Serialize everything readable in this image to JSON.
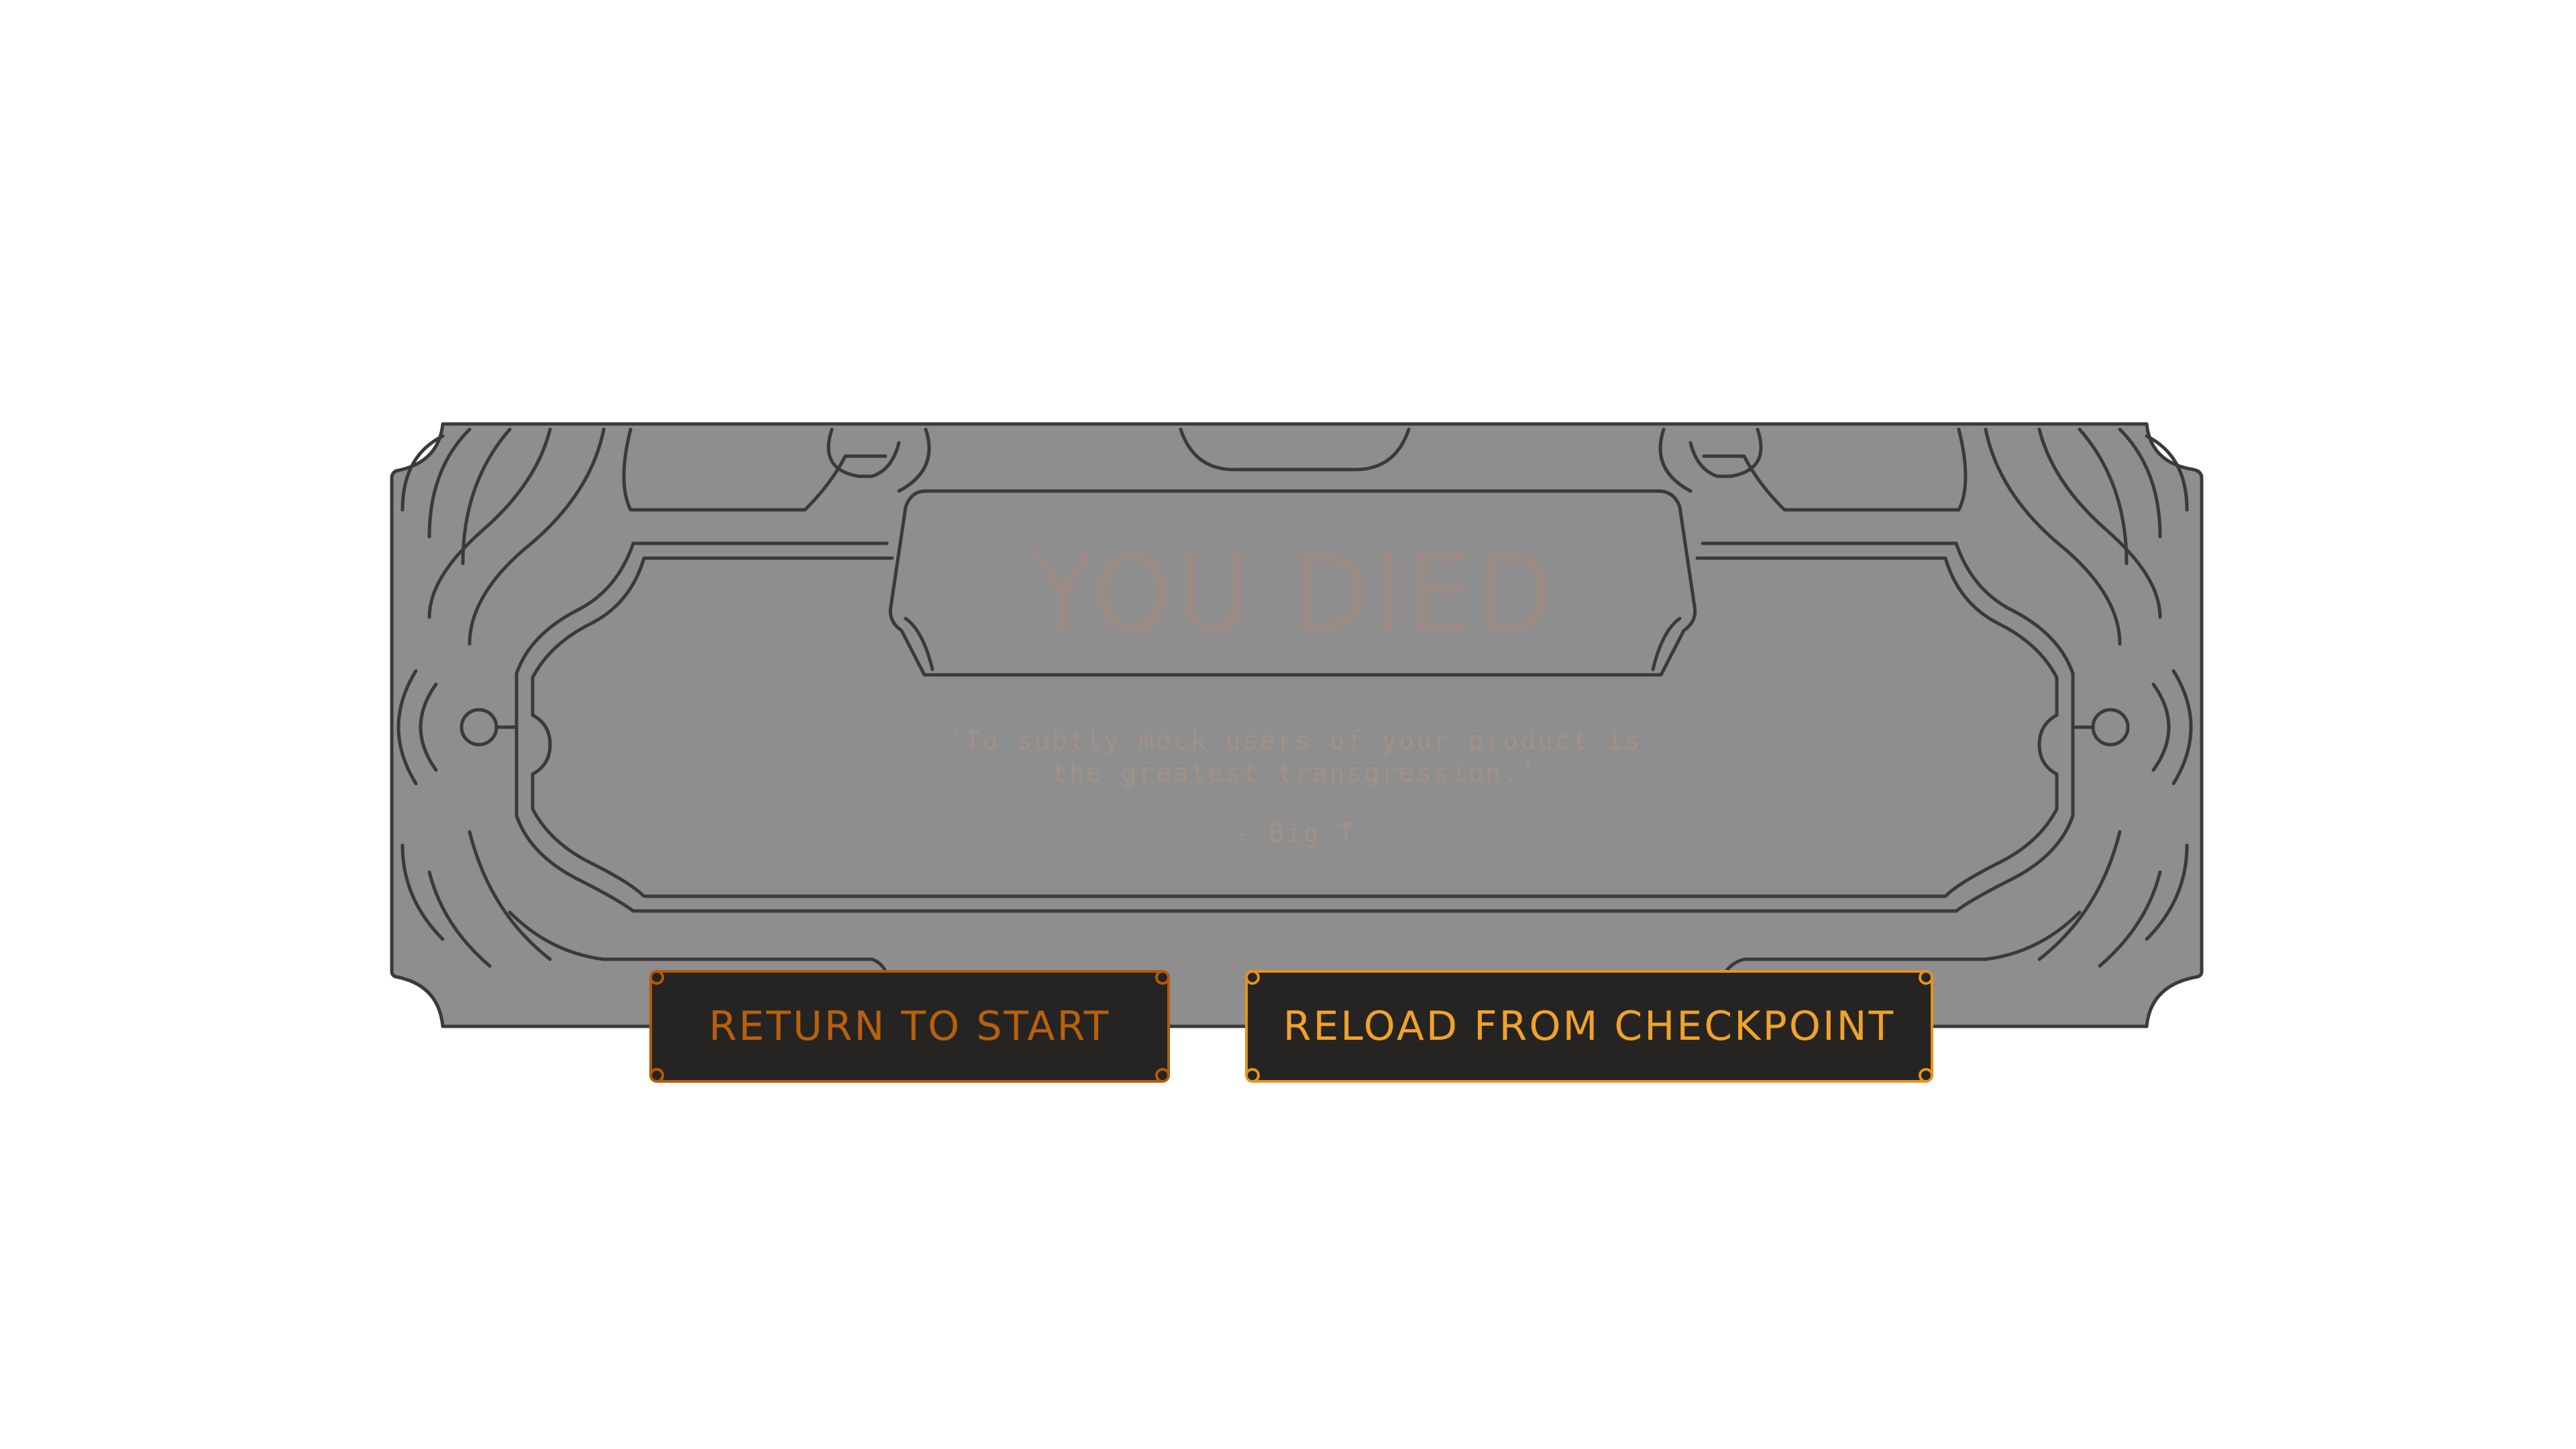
{
  "dialog": {
    "title": "YOU DIED",
    "quote_line1": "'To subtly mock users of your product is",
    "quote_line2": "the greatest transgression.'",
    "author": "- Big T"
  },
  "buttons": {
    "return_label": "RETURN TO START",
    "reload_label": "RELOAD FROM CHECKPOINT"
  },
  "colors": {
    "panel_fill": "#8e8e8e",
    "panel_stroke": "#3a3a3a",
    "title_text": "#9a8c84",
    "button_bg": "#262423",
    "return_accent": "#b45a0a",
    "reload_accent": "#e6941c"
  }
}
